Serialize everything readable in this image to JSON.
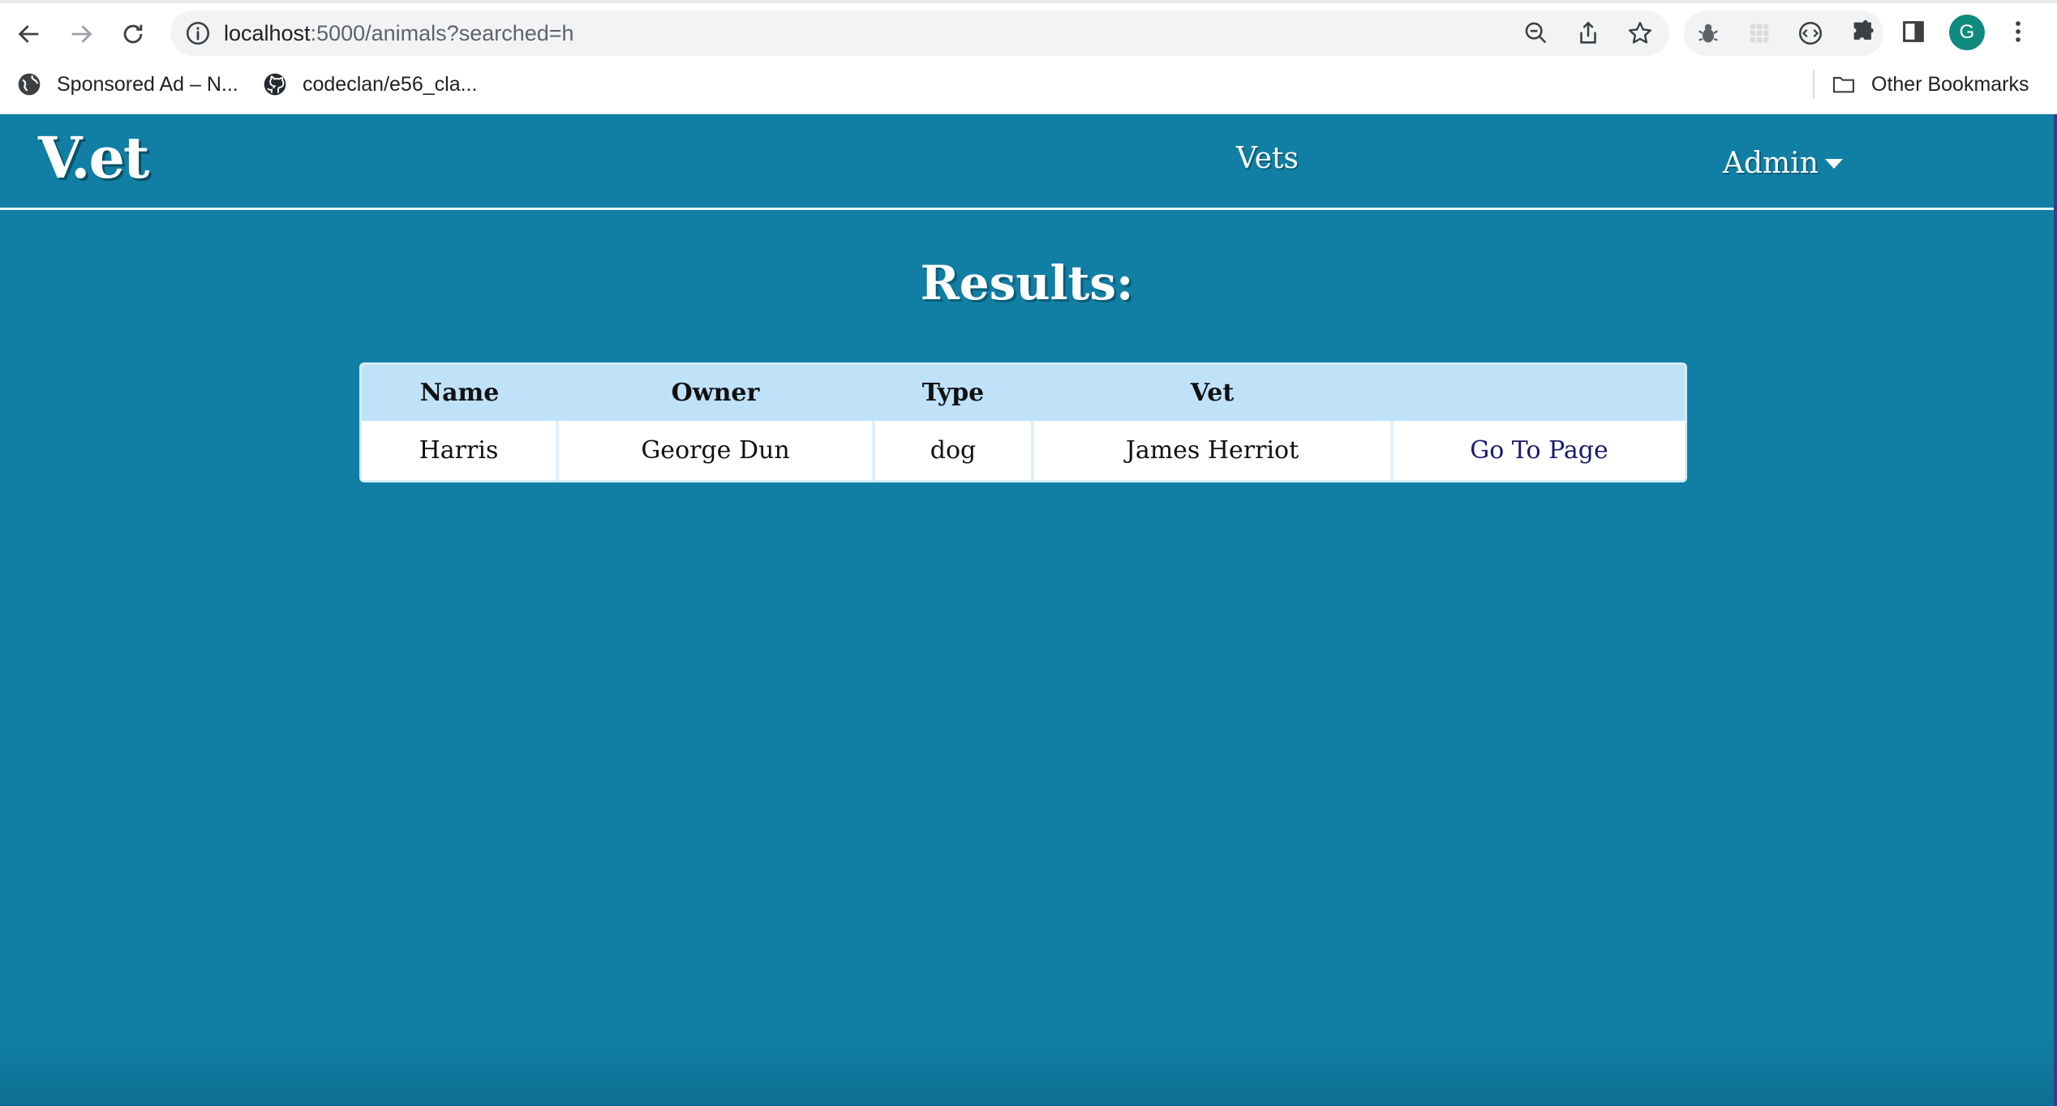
{
  "browser": {
    "url_host": "localhost",
    "url_rest": ":5000/animals?searched=h",
    "profile_initial": "G",
    "bookmarks": [
      {
        "label": "Sponsored Ad – N...",
        "icon": "globe-icon"
      },
      {
        "label": "codeclan/e56_cla...",
        "icon": "github-icon"
      }
    ],
    "other_bookmarks": "Other Bookmarks"
  },
  "site": {
    "logo": "V.et",
    "nav": {
      "vets": "Vets",
      "admin": "Admin"
    }
  },
  "results": {
    "title": "Results:",
    "columns": [
      "Name",
      "Owner",
      "Type",
      "Vet",
      ""
    ],
    "rows": [
      {
        "name": "Harris",
        "owner": "George Dun",
        "type": "dog",
        "vet": "James Herriot",
        "link": "Go To Page"
      }
    ]
  },
  "colors": {
    "page_bg": "#117fa4",
    "table_header_bg": "#c0e2f9",
    "link": "#1a1a6e",
    "profile": "#0f8a7c"
  }
}
